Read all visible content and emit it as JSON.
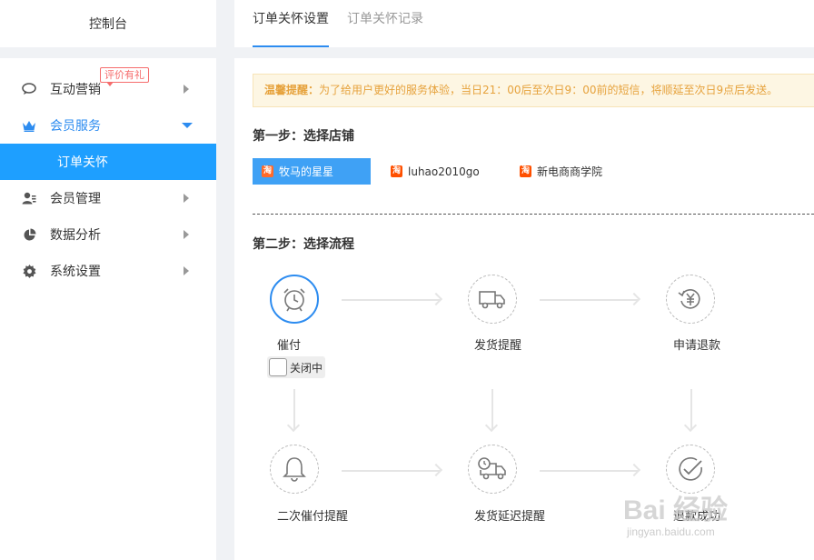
{
  "sidebar": {
    "title": "控制台",
    "items": [
      {
        "label": "互动营销",
        "icon": "chat-bubble-icon",
        "badge": "评价有礼"
      },
      {
        "label": "会员服务",
        "icon": "crown-icon",
        "expanded": true
      },
      {
        "label": "订单关怀",
        "active": true
      },
      {
        "label": "会员管理",
        "icon": "user-manage-icon"
      },
      {
        "label": "数据分析",
        "icon": "pie-chart-icon"
      },
      {
        "label": "系统设置",
        "icon": "gear-icon"
      }
    ]
  },
  "tabs": [
    {
      "label": "订单关怀设置",
      "active": true
    },
    {
      "label": "订单关怀记录",
      "active": false
    }
  ],
  "notice": {
    "prefix": "温馨提醒：",
    "text": "为了给用户更好的服务体验，当日21：00后至次日9：00前的短信，将顺延至次日9点后发送。"
  },
  "step1": {
    "title": "第一步：选择店铺",
    "shops": [
      {
        "name": "牧马的星星",
        "selected": true
      },
      {
        "name": "luhao2010go",
        "selected": false
      },
      {
        "name": "新电商商学院",
        "selected": false
      }
    ],
    "shop_icon_text": "淘"
  },
  "step2": {
    "title": "第二步：选择流程",
    "nodes": [
      {
        "label": "催付",
        "icon": "alarm-clock-icon",
        "active": true
      },
      {
        "label": "发货提醒",
        "icon": "delivery-truck-icon"
      },
      {
        "label": "申请退款",
        "icon": "refund-icon"
      },
      {
        "label": "二次催付提醒",
        "icon": "bell-icon"
      },
      {
        "label": "发货延迟提醒",
        "icon": "delayed-truck-icon"
      },
      {
        "label": "退款成功",
        "icon": "check-circle-icon"
      }
    ],
    "toggle_label": "关闭中"
  },
  "watermark": {
    "main": "Bai 经验",
    "sub": "jingyan.baidu.com"
  },
  "colors": {
    "accent": "#2d8cf0",
    "selected_bg": "#3fa1f5",
    "notice_text": "#e6a23c",
    "badge": "#f56c6c"
  }
}
